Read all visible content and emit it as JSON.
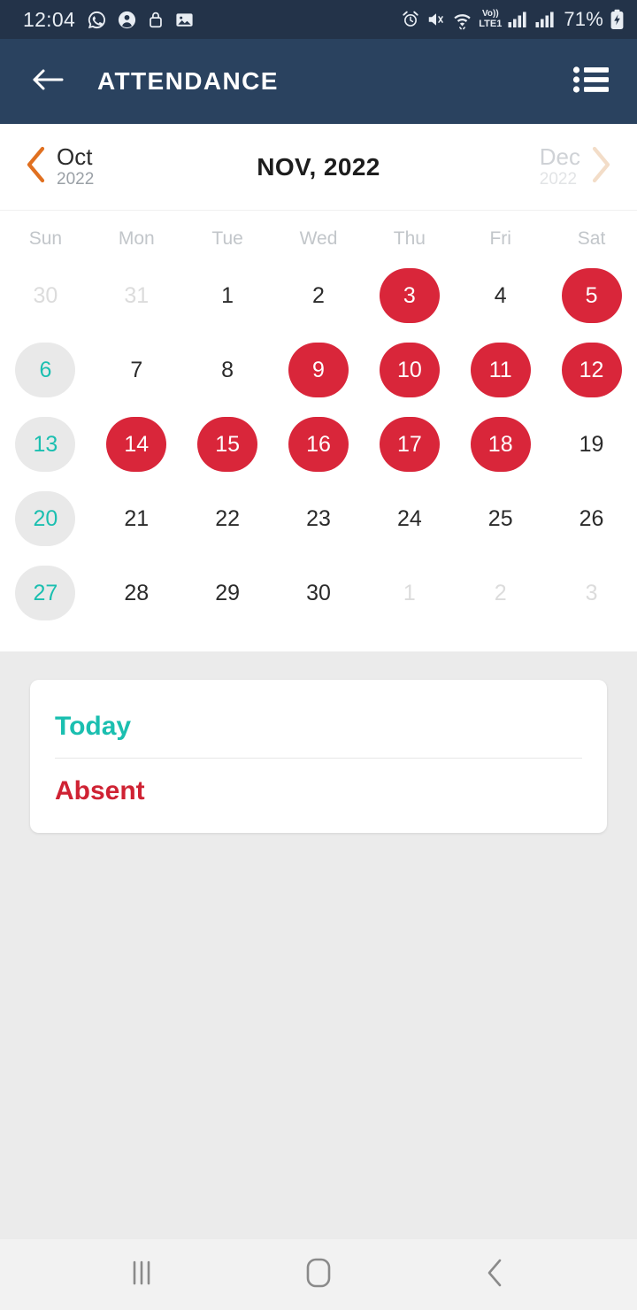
{
  "status_bar": {
    "time": "12:04",
    "battery_percent": "71%",
    "network_label_top": "Vo))",
    "network_label_bottom": "LTE1",
    "icons": [
      "whatsapp-icon",
      "contact-icon",
      "lock-icon",
      "gallery-icon",
      "alarm-icon",
      "mute-icon",
      "wifi-icon",
      "volte-icon",
      "signal-sim1-icon",
      "signal-sim2-icon",
      "battery-charging-icon"
    ]
  },
  "app_bar": {
    "title": "ATTENDANCE",
    "back_icon": "arrow-left-icon",
    "menu_icon": "list-menu-icon",
    "background": "#2a425f"
  },
  "month_nav": {
    "prev_month": "Oct",
    "prev_year": "2022",
    "current": "NOV, 2022",
    "next_month": "Dec",
    "next_year": "2022",
    "prev_chevron": "chevron-left-icon",
    "next_chevron": "chevron-right-icon",
    "prev_chevron_color": "#e07020",
    "next_chevron_color": "#f3ddc8"
  },
  "calendar": {
    "weekdays": [
      "Sun",
      "Mon",
      "Tue",
      "Wed",
      "Thu",
      "Fri",
      "Sat"
    ],
    "days": [
      {
        "label": "30",
        "state": "muted"
      },
      {
        "label": "31",
        "state": "muted"
      },
      {
        "label": "1",
        "state": "normal"
      },
      {
        "label": "2",
        "state": "normal"
      },
      {
        "label": "3",
        "state": "absent"
      },
      {
        "label": "4",
        "state": "normal"
      },
      {
        "label": "5",
        "state": "absent"
      },
      {
        "label": "6",
        "state": "today"
      },
      {
        "label": "7",
        "state": "normal"
      },
      {
        "label": "8",
        "state": "normal"
      },
      {
        "label": "9",
        "state": "absent"
      },
      {
        "label": "10",
        "state": "absent"
      },
      {
        "label": "11",
        "state": "absent"
      },
      {
        "label": "12",
        "state": "absent"
      },
      {
        "label": "13",
        "state": "today"
      },
      {
        "label": "14",
        "state": "absent"
      },
      {
        "label": "15",
        "state": "absent"
      },
      {
        "label": "16",
        "state": "absent"
      },
      {
        "label": "17",
        "state": "absent"
      },
      {
        "label": "18",
        "state": "absent"
      },
      {
        "label": "19",
        "state": "normal"
      },
      {
        "label": "20",
        "state": "today"
      },
      {
        "label": "21",
        "state": "normal"
      },
      {
        "label": "22",
        "state": "normal"
      },
      {
        "label": "23",
        "state": "normal"
      },
      {
        "label": "24",
        "state": "normal"
      },
      {
        "label": "25",
        "state": "normal"
      },
      {
        "label": "26",
        "state": "normal"
      },
      {
        "label": "27",
        "state": "today"
      },
      {
        "label": "28",
        "state": "normal"
      },
      {
        "label": "29",
        "state": "normal"
      },
      {
        "label": "30",
        "state": "normal"
      },
      {
        "label": "1",
        "state": "muted"
      },
      {
        "label": "2",
        "state": "muted"
      },
      {
        "label": "3",
        "state": "muted"
      }
    ]
  },
  "legend": {
    "today_label": "Today",
    "absent_label": "Absent",
    "today_color": "#1bbfb0",
    "absent_color": "#cf2233"
  },
  "nav_bar": {
    "recents_icon": "recents-icon",
    "home_icon": "home-icon",
    "back_icon": "back-icon"
  }
}
